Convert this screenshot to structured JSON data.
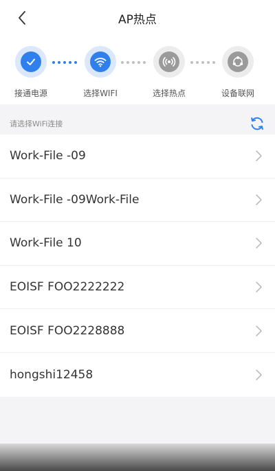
{
  "header": {
    "title": "AP热点"
  },
  "steps": [
    {
      "label": "接通电源",
      "icon": "check-icon"
    },
    {
      "label": "选择WIFI",
      "icon": "wifi-icon"
    },
    {
      "label": "选择热点",
      "icon": "hotspot-icon"
    },
    {
      "label": "设备联网",
      "icon": "network-icon"
    }
  ],
  "section": {
    "title": "请选择WiFi连接",
    "refresh_icon": "refresh-icon"
  },
  "networks": [
    "Work-File -09",
    "Work-File -09Work-File",
    "Work-File 10",
    "EOISF FOO2222222",
    "EOISF FOO2228888",
    "hongshi12458"
  ],
  "colors": {
    "accent": "#2f80ed",
    "inactive": "#9a9a9a"
  }
}
